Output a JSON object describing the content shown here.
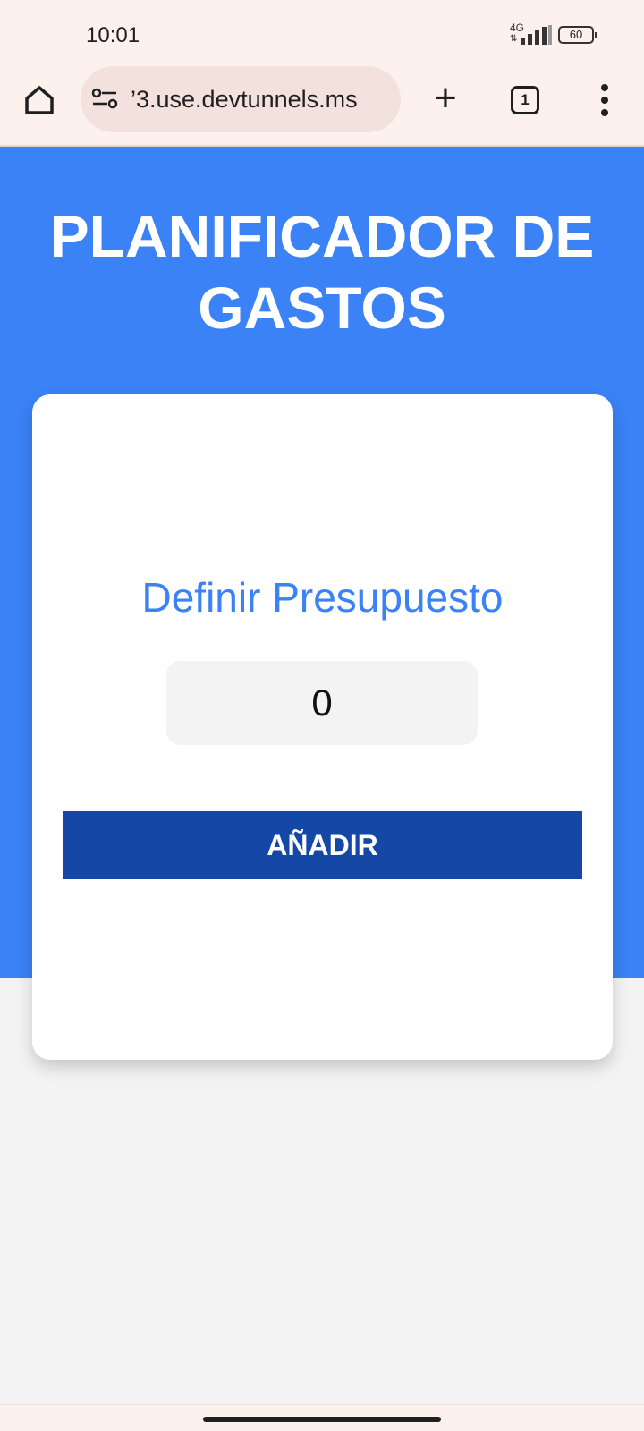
{
  "status_bar": {
    "time": "10:01",
    "network": "4G",
    "battery": "60"
  },
  "browser": {
    "url": "’3.use.devtunnels.ms",
    "tab_count": "1",
    "icons": [
      "home-icon",
      "tune-icon",
      "plus-icon",
      "tab-count-icon",
      "more-vert-icon"
    ]
  },
  "page": {
    "title": "PLANIFICADOR DE GASTOS",
    "heading": "Definir Presupuesto",
    "budget_value": "0",
    "add_button_label": "AÑADIR"
  },
  "colors": {
    "hero": "#3b82f6",
    "button": "#1548a6",
    "heading": "#3b82f6",
    "background": "#f3f3f3"
  }
}
